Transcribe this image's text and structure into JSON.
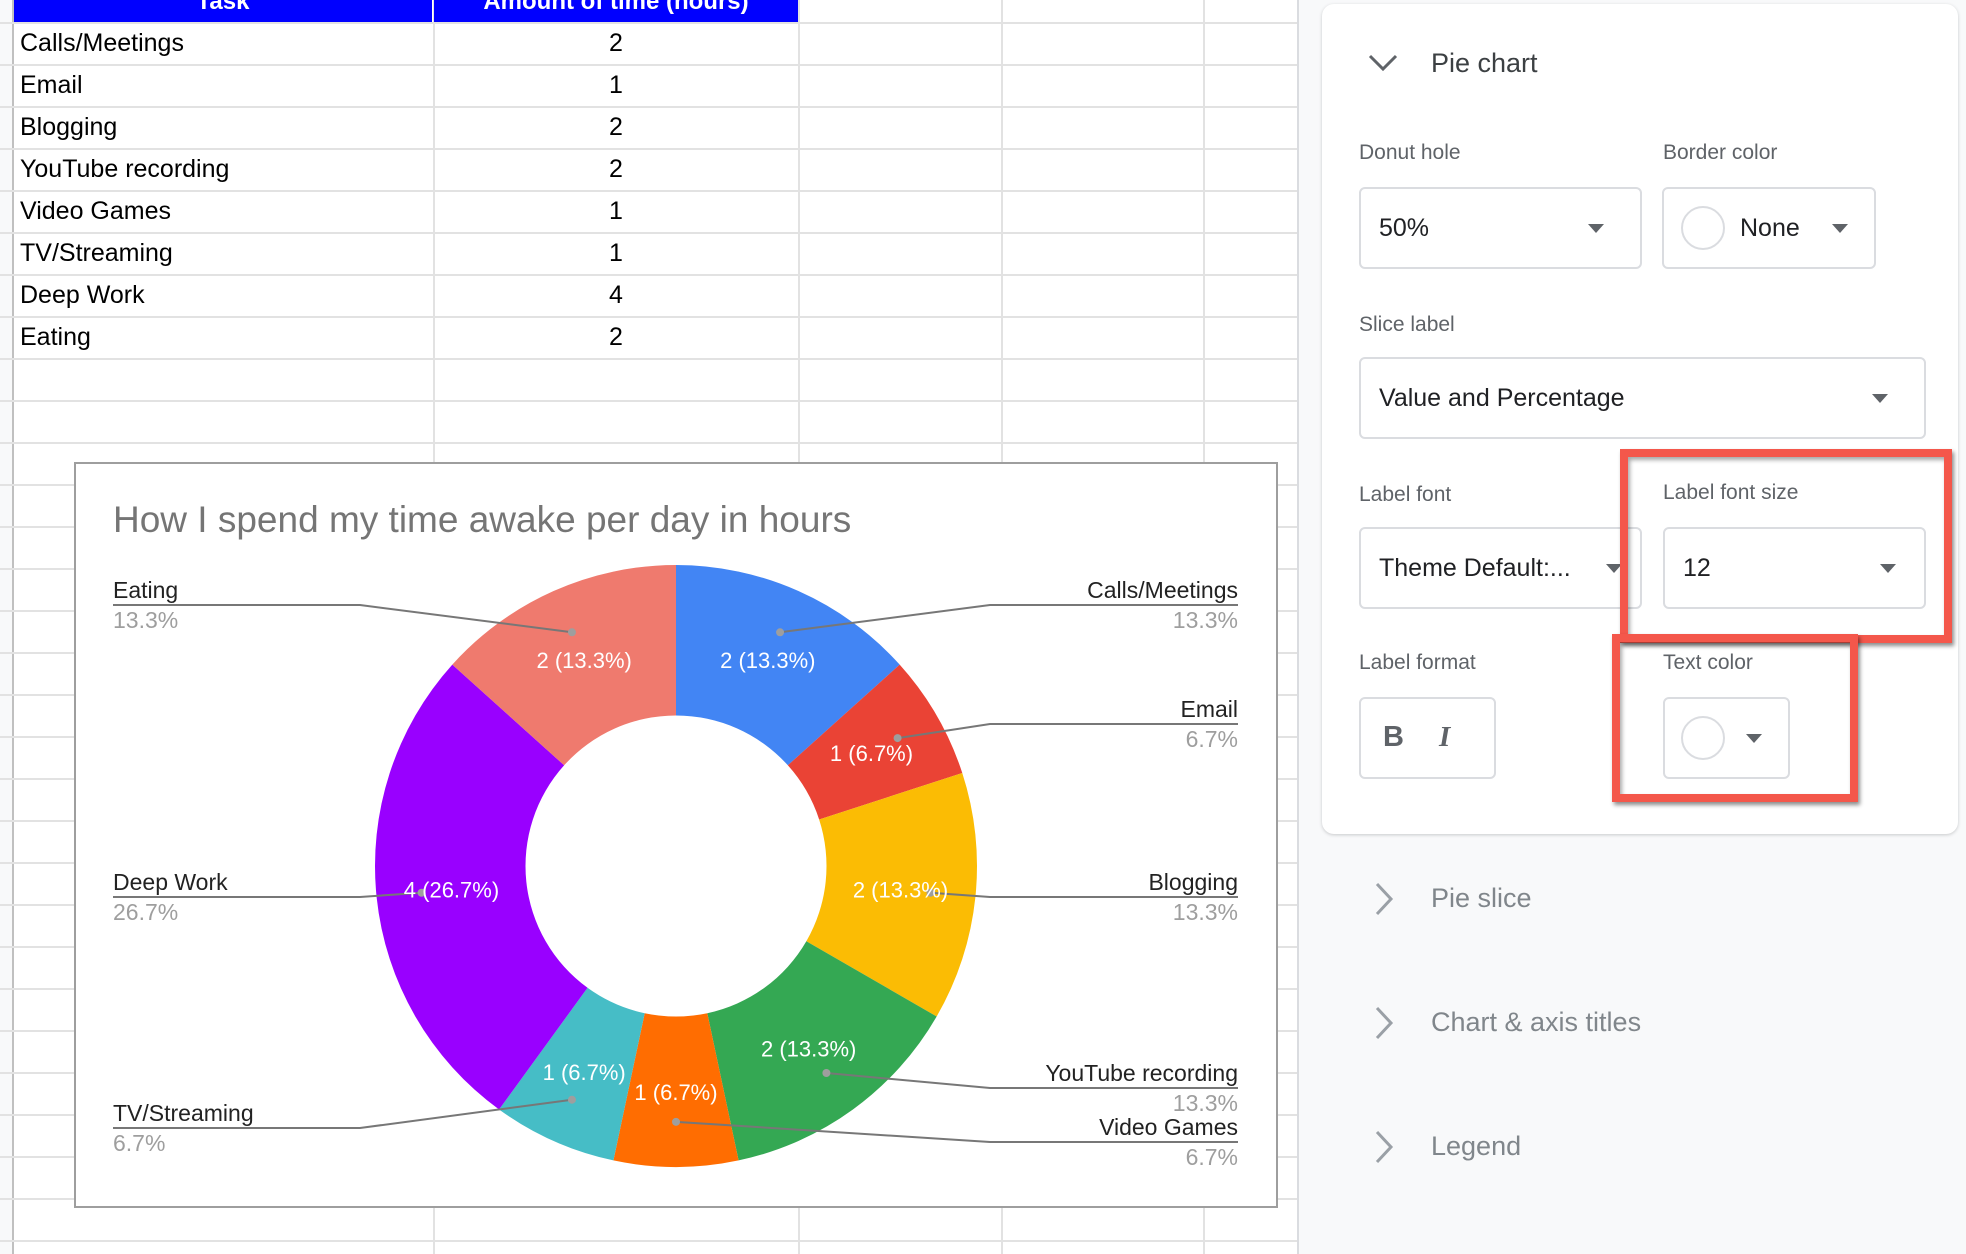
{
  "sheet": {
    "headers": [
      "Task",
      "Amount of time (hours)"
    ],
    "rows": [
      {
        "task": "Calls/Meetings",
        "amount": "2"
      },
      {
        "task": "Email",
        "amount": "1"
      },
      {
        "task": "Blogging",
        "amount": "2"
      },
      {
        "task": "YouTube recording",
        "amount": "2"
      },
      {
        "task": "Video Games",
        "amount": "1"
      },
      {
        "task": "TV/Streaming",
        "amount": "1"
      },
      {
        "task": "Deep Work",
        "amount": "4"
      },
      {
        "task": "Eating",
        "amount": "2"
      }
    ],
    "header_color": "#0000ff"
  },
  "chart_data": {
    "type": "pie",
    "title": "How I spend my time awake per day in hours",
    "donut_hole": 0.5,
    "categories": [
      "Calls/Meetings",
      "Email",
      "Blogging",
      "YouTube recording",
      "Video Games",
      "TV/Streaming",
      "Deep Work",
      "Eating"
    ],
    "values": [
      2,
      1,
      2,
      2,
      1,
      1,
      4,
      2
    ],
    "percentages": [
      "13.3%",
      "6.7%",
      "13.3%",
      "13.3%",
      "6.7%",
      "6.7%",
      "26.7%",
      "13.3%"
    ],
    "slice_labels": [
      "2 (13.3%)",
      "1 (6.7%)",
      "2 (13.3%)",
      "2 (13.3%)",
      "1 (6.7%)",
      "1 (6.7%)",
      "4 (26.7%)",
      "2 (13.3%)"
    ],
    "colors": [
      "#4285f4",
      "#ea4335",
      "#fbbc04",
      "#34a853",
      "#ff6d01",
      "#46bdc6",
      "#9900ff",
      "#ef7a6e"
    ],
    "label_sides": [
      "right",
      "right",
      "right",
      "right",
      "right",
      "left",
      "left",
      "left"
    ],
    "legend": "labeled",
    "slice_label_color": "#ffffff"
  },
  "panel": {
    "pie_chart_section": {
      "title": "Pie chart",
      "donut_hole": {
        "label": "Donut hole",
        "value": "50%"
      },
      "border_color": {
        "label": "Border color",
        "value": "None"
      },
      "slice_label": {
        "label": "Slice label",
        "value": "Value and Percentage"
      },
      "label_font": {
        "label": "Label font",
        "value": "Theme Default:..."
      },
      "label_font_size": {
        "label": "Label font size",
        "value": "12"
      },
      "label_format": {
        "label": "Label format",
        "bold": "B",
        "italic": "I"
      },
      "text_color": {
        "label": "Text color"
      }
    },
    "collapsed_sections": [
      "Pie slice",
      "Chart & axis titles",
      "Legend"
    ],
    "highlight_color": "#f4574b"
  }
}
